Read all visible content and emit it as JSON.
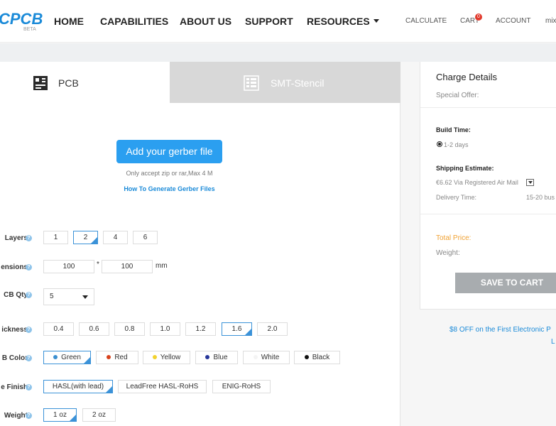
{
  "header": {
    "logo": "CPCB",
    "logo_badge": "BETA",
    "nav": [
      "HOME",
      "CAPABILITIES",
      "ABOUT US",
      "SUPPORT",
      "RESOURCES"
    ],
    "utility": {
      "calculate": "CALCULATE",
      "cart": "CART",
      "cart_count": "0",
      "account": "ACCOUNT",
      "user": "mix"
    }
  },
  "tabs": {
    "pcb": "PCB",
    "smt": "SMT-Stencil"
  },
  "upload": {
    "button": "Add your gerber file",
    "note": "Only accept zip or rar,Max 4 M",
    "link": "How To Generate Gerber Files"
  },
  "form": {
    "layers": {
      "label": "Layers",
      "options": [
        "1",
        "2",
        "4",
        "6"
      ],
      "selected": "2"
    },
    "dimensions": {
      "label": "ensions",
      "width": "100",
      "separator": "*",
      "height": "100",
      "unit": "mm"
    },
    "qty": {
      "label": "CB Qty",
      "value": "5"
    },
    "thickness": {
      "label": "ickness",
      "options": [
        "0.4",
        "0.6",
        "0.8",
        "1.0",
        "1.2",
        "1.6",
        "2.0"
      ],
      "selected": "1.6"
    },
    "color": {
      "label": "B Color",
      "options": [
        {
          "name": "Green",
          "dot": "#3b8fd0"
        },
        {
          "name": "Red",
          "dot": "#d8421c"
        },
        {
          "name": "Yellow",
          "dot": "#f2d22e"
        },
        {
          "name": "Blue",
          "dot": "#26369a"
        },
        {
          "name": "White",
          "dot": "#f4f4f4"
        },
        {
          "name": "Black",
          "dot": "#111111"
        }
      ],
      "selected": "Green"
    },
    "finish": {
      "label": "e Finish",
      "options": [
        "HASL(with lead)",
        "LeadFree HASL-RoHS",
        "ENIG-RoHS"
      ],
      "selected": "HASL(with lead)"
    },
    "weight": {
      "label": "Weight",
      "options": [
        "1 oz",
        "2 oz"
      ],
      "selected": "1 oz"
    }
  },
  "charge": {
    "title": "Charge Details",
    "special_offer": "Special Offer:",
    "build_time_label": "Build Time:",
    "build_time_option": "1-2 days",
    "shipping_label": "Shipping Estimate:",
    "shipping_value": "€6.62 Via  Registered Air Mail",
    "delivery_label": "Delivery Time:",
    "delivery_value": "15-20 bus",
    "total_label": "Total Price:",
    "weight_label": "Weight:",
    "save_button": "SAVE TO CART"
  },
  "promo": {
    "line1": "$8 OFF on the First Electronic P",
    "line2": "L"
  },
  "colors": {
    "accent": "#2b9ff0",
    "link": "#1a8ad8",
    "total": "#f0a030"
  }
}
